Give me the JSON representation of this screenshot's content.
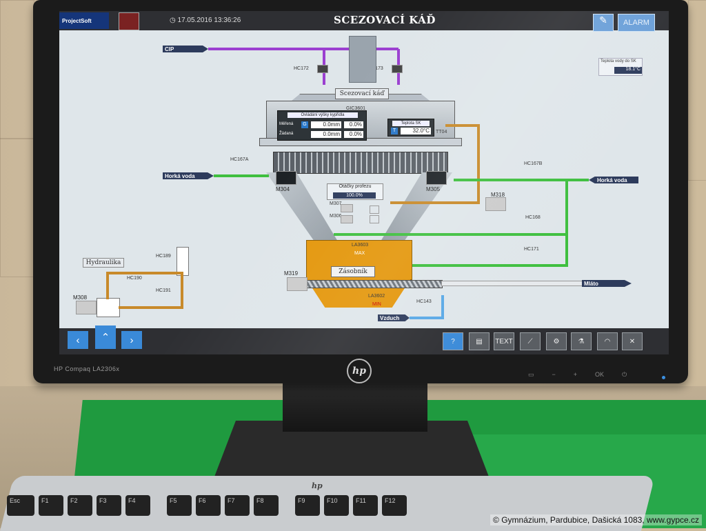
{
  "screen": {
    "logo": "ProjectSoft",
    "datetime": "17.05.2016 13:36:26",
    "title": "SCEZOVACÍ KÁĎ",
    "alarm_label": "ALARM",
    "water_temp": {
      "title": "Teplota vody do SK",
      "value": "18.1°C"
    }
  },
  "process": {
    "cip": "CIP",
    "hot_water_left": "Horká voda",
    "hot_water_right": "Horká voda",
    "vessel_label": "Scezovací káď",
    "hydraulics": "Hydraulika",
    "tank_label": "Zásobník",
    "spent_grain": "Mláto",
    "air": "Vzduch",
    "valves": {
      "hc172": "HC172",
      "hc173": "HC173",
      "hc167a": "HC167A",
      "hc167b": "HC167B",
      "hc168": "HC168",
      "hc171": "HC171",
      "hc143": "HC143",
      "hc189": "HC189",
      "hc190": "HC190",
      "hc191": "HC191"
    },
    "motors": {
      "m304": "M304",
      "m305": "M305",
      "m318": "M318",
      "m319": "M319",
      "m308": "M308",
      "m307": "M307",
      "m306": "M306"
    },
    "sensors": {
      "gic": "GIC3601",
      "la3603": "LA3603",
      "la3602": "LA3602",
      "tt": "TT04",
      "max": "MAX",
      "min": "MIN"
    },
    "height_panel": {
      "title": "Ovládání výšky kypřidla",
      "measured_label": "Měřená",
      "set_label": "Žádaná",
      "measured_mm": "0.0mm",
      "measured_pct": "0.0%",
      "set_mm": "0.0mm",
      "set_pct": "0.0%",
      "g_btn": "G"
    },
    "temp_panel": {
      "title": "Teplota SK",
      "value": "32.0°C",
      "t_btn": "T"
    },
    "rake_panel": {
      "title": "Otáčky profezu",
      "value": "100.0%"
    }
  },
  "toolbar": {
    "help": "?",
    "text": "TEXT"
  },
  "monitor": {
    "model": "HP Compaq LA2306x",
    "brand": "hp"
  },
  "keyboard": {
    "keys": [
      "Esc",
      "F1",
      "F2",
      "F3",
      "F4",
      "F5",
      "F6",
      "F7",
      "F8",
      "F9",
      "F10",
      "F11",
      "F12"
    ],
    "brand": "hp"
  },
  "copyright": "© Gymnázium, Pardubice, Dašická 1083, www.gypce.cz",
  "colors": {
    "cip": "#9b3fd0",
    "hot_water": "#3fbf3f",
    "hydraulic": "#c88a2a",
    "tank": "#e4970c",
    "air": "#5aa9e6"
  }
}
